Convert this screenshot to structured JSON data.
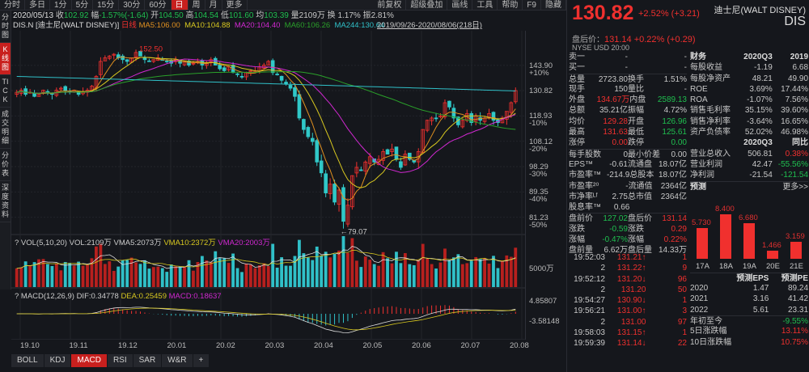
{
  "toolbar": {
    "items": [
      "分时",
      "多日",
      "1分",
      "5分",
      "15分",
      "30分",
      "60分",
      "日",
      "周",
      "月",
      "更多"
    ],
    "active": 7,
    "right_items": [
      "前复权",
      "超级叠加",
      "画线",
      "工具",
      "帮助",
      "F9",
      "隐藏"
    ]
  },
  "sidebar": [
    "分时图",
    "K线图",
    "TICK",
    "成交明细",
    "分价表",
    "深度资料"
  ],
  "sidebar_active": 1,
  "info": {
    "date": "2020/05/13",
    "close_label": "收",
    "close": "102.92",
    "amp_label": "幅",
    "amp": "-1.57%(-1.64)",
    "open_label": "开",
    "open": "104.50",
    "high_label": "高",
    "high": "104.54",
    "low_label": "低",
    "low": "101.60",
    "avg_label": "均",
    "avg": "103.39",
    "vol": "量2109万",
    "turnover": "换 1.17%",
    "swing": "振2.81%"
  },
  "ma_header": {
    "symbol": "DIS.N [迪士尼(WALT DISNEY)]",
    "period": "日线",
    "ma5": "MA5:106.00",
    "ma10": "MA10:104.88",
    "ma20": "MA20:104.40",
    "ma60": "MA60:106.26",
    "ma244": "MA244:130.64",
    "range": "2019/09/26-2020/08/06(218日)"
  },
  "annotations": {
    "high": "152.50",
    "low": "79.07"
  },
  "yaxis": [
    [
      "143.90",
      "+10%"
    ],
    [
      "130.82",
      ""
    ],
    [
      "118.93",
      "-10%"
    ],
    [
      "108.12",
      "-20%"
    ],
    [
      "98.29",
      "-30%"
    ],
    [
      "89.35",
      "-40%"
    ],
    [
      "81.23",
      "-50%"
    ]
  ],
  "vol_header": {
    "title": "VOL(5,10,20)",
    "vol": "VOL:2109万",
    "vma5": "VMA5:2073万",
    "vma10": "VMA10:2372万",
    "vma20": "VMA20:2003万",
    "axis": "5000万"
  },
  "macd_header": {
    "title": "MACD(12,26,9)",
    "dif": "DIF:0.34778",
    "dea": "DEA:0.25459",
    "macd": "MACD:0.18637",
    "axis_top": "4.85807",
    "axis_bottom": "-3.58148"
  },
  "xaxis": [
    "19.10",
    "19.11",
    "19.12",
    "20.01",
    "20.02",
    "20.03",
    "20.04",
    "20.05",
    "20.06",
    "20.07",
    "20.08"
  ],
  "indicator_tabs": [
    "BOLL",
    "KDJ",
    "MACD",
    "RSI",
    "SAR",
    "W&R",
    "+"
  ],
  "indicator_active": 2,
  "chart_data": {
    "type": "candlestick",
    "closes": [
      130,
      131,
      129,
      130,
      128,
      129,
      131,
      130,
      129,
      131,
      132,
      131,
      130,
      131,
      129,
      130,
      131,
      133,
      138,
      146,
      148,
      149,
      150,
      148,
      147,
      146,
      148,
      151,
      149,
      147,
      146,
      147,
      148,
      147,
      146,
      145,
      147,
      145,
      146,
      144,
      145,
      146,
      144,
      145,
      147,
      144,
      142,
      141,
      143,
      140,
      139,
      138,
      140,
      141,
      141,
      143,
      144,
      146,
      140,
      139,
      136,
      134,
      132,
      128,
      118,
      113,
      110,
      108,
      100,
      96,
      89,
      92,
      86,
      90,
      80,
      85,
      95,
      98,
      97,
      100,
      102,
      100,
      101,
      104,
      103,
      105,
      101,
      98,
      103,
      101,
      100,
      104,
      113,
      117,
      118,
      118,
      119,
      125,
      123,
      118,
      115,
      117,
      120,
      116,
      119,
      117,
      118,
      120,
      117,
      116,
      118,
      121,
      125,
      130.82
    ],
    "ma244": 130.64
  },
  "quote": {
    "price": "130.82",
    "change": "+2.52% (+3.21)",
    "name": "迪士尼(WALT DISNEY)",
    "code": "DIS",
    "after_label": "盘后价：",
    "after": "131.14 +0.22% (+0.29)",
    "exchange": "NYSE  USD  20:00"
  },
  "left_panel": [
    [
      "卖一",
      "-",
      "",
      "-"
    ],
    [
      "买一",
      "-",
      "",
      "-"
    ],
    [
      "总量",
      "2723.80",
      "换手",
      "1.51%"
    ],
    [
      "现手",
      "150",
      "量比",
      "-"
    ],
    [
      "外盘",
      "134.67万",
      "内盘",
      "2589.13"
    ],
    [
      "总额",
      "35.21亿",
      "振幅",
      "4.72%"
    ],
    [
      "均价",
      "129.28",
      "开盘",
      "126.96"
    ],
    [
      "最高",
      "131.63",
      "最低",
      "125.61"
    ],
    [
      "涨停",
      "0.00",
      "跌停",
      "0.00"
    ],
    [
      "每手股数",
      "0",
      "最小价差",
      "0.00"
    ],
    [
      "EPS™",
      "-0.61",
      "流通盘",
      "18.07亿"
    ],
    [
      "市盈率™",
      "-214.9",
      "总股本",
      "18.07亿"
    ],
    [
      "市盈率²⁰",
      "-",
      "流通值",
      "2364亿"
    ],
    [
      "市净率ᴸᶠ",
      "2.75",
      "总市值",
      "2364亿"
    ],
    [
      "股息率™",
      "0.66",
      "",
      ""
    ],
    [
      "盘前价",
      "127.02",
      "盘后价",
      "131.14"
    ],
    [
      "涨跌",
      "-0.59",
      "涨跌",
      "0.29"
    ],
    [
      "涨幅",
      "-0.47%",
      "涨幅",
      "0.22%"
    ],
    [
      "盘前量",
      "6.62万",
      "盘后量",
      "14.33万"
    ]
  ],
  "left_colors": [
    "",
    "",
    "",
    "",
    "rg",
    "",
    "rg",
    "rg",
    "rg",
    "",
    "",
    "",
    "",
    "",
    "",
    "gr",
    "gr",
    "gr",
    ""
  ],
  "ticks": [
    [
      "19:52:03",
      "131.21",
      "up",
      "1"
    ],
    [
      "2",
      "131.22",
      "up",
      "9"
    ],
    [
      "19:52:12",
      "131.20",
      "down",
      "96"
    ],
    [
      "2",
      "131.20",
      "",
      "50"
    ],
    [
      "19:54:27",
      "130.90",
      "down",
      "1"
    ],
    [
      "19:56:21",
      "131.00",
      "up",
      "3"
    ],
    [
      "2",
      "131.00",
      "",
      "97"
    ],
    [
      "19:58:03",
      "131.15",
      "up",
      "1"
    ],
    [
      "19:59:39",
      "131.14",
      "down",
      "22"
    ]
  ],
  "finance": {
    "header": [
      "财务",
      "2020Q3",
      "2019"
    ],
    "rows": [
      [
        "每股收益",
        "-1.19",
        "6.68"
      ],
      [
        "每股净资产",
        "48.21",
        "49.90"
      ],
      [
        "ROE",
        "3.69%",
        "17.44%"
      ],
      [
        "ROA",
        "-1.07%",
        "7.56%"
      ],
      [
        "销售毛利率",
        "35.15%",
        "39.60%"
      ],
      [
        "销售净利率",
        "-3.64%",
        "16.65%"
      ],
      [
        "资产负债率",
        "52.02%",
        "46.98%"
      ]
    ],
    "header2": [
      "",
      "2020Q3",
      "同比"
    ],
    "rows2": [
      [
        "营业总收入",
        "506.81",
        "0.38%"
      ],
      [
        "营业利润",
        "42.47",
        "-55.56%"
      ],
      [
        "净利润",
        "-21.54",
        "-121.54"
      ]
    ]
  },
  "forecast": {
    "title": "预测",
    "more": "更多>>",
    "labels": [
      "17A",
      "18A",
      "19A",
      "20E",
      "21E"
    ],
    "values": [
      5.73,
      8.4,
      6.68,
      1.466,
      3.159
    ],
    "value_labels": [
      "5.730",
      "8.400",
      "6.680",
      "1.466",
      "3.159"
    ],
    "header": [
      "",
      "预测EPS",
      "预测PE"
    ],
    "rows": [
      [
        "2020",
        "1.47",
        "89.24"
      ],
      [
        "2021",
        "3.16",
        "41.42"
      ],
      [
        "2022",
        "5.61",
        "23.31"
      ]
    ],
    "perf": [
      [
        "年初至今",
        "-9.55%"
      ],
      [
        "5日涨跌幅",
        "13.11%"
      ],
      [
        "10日涨跌幅",
        "10.75%"
      ]
    ]
  },
  "colors": {
    "up": "#f0302e",
    "down": "#1fbf4f",
    "cyan": "#30c0c8",
    "bg": "#15171c"
  }
}
